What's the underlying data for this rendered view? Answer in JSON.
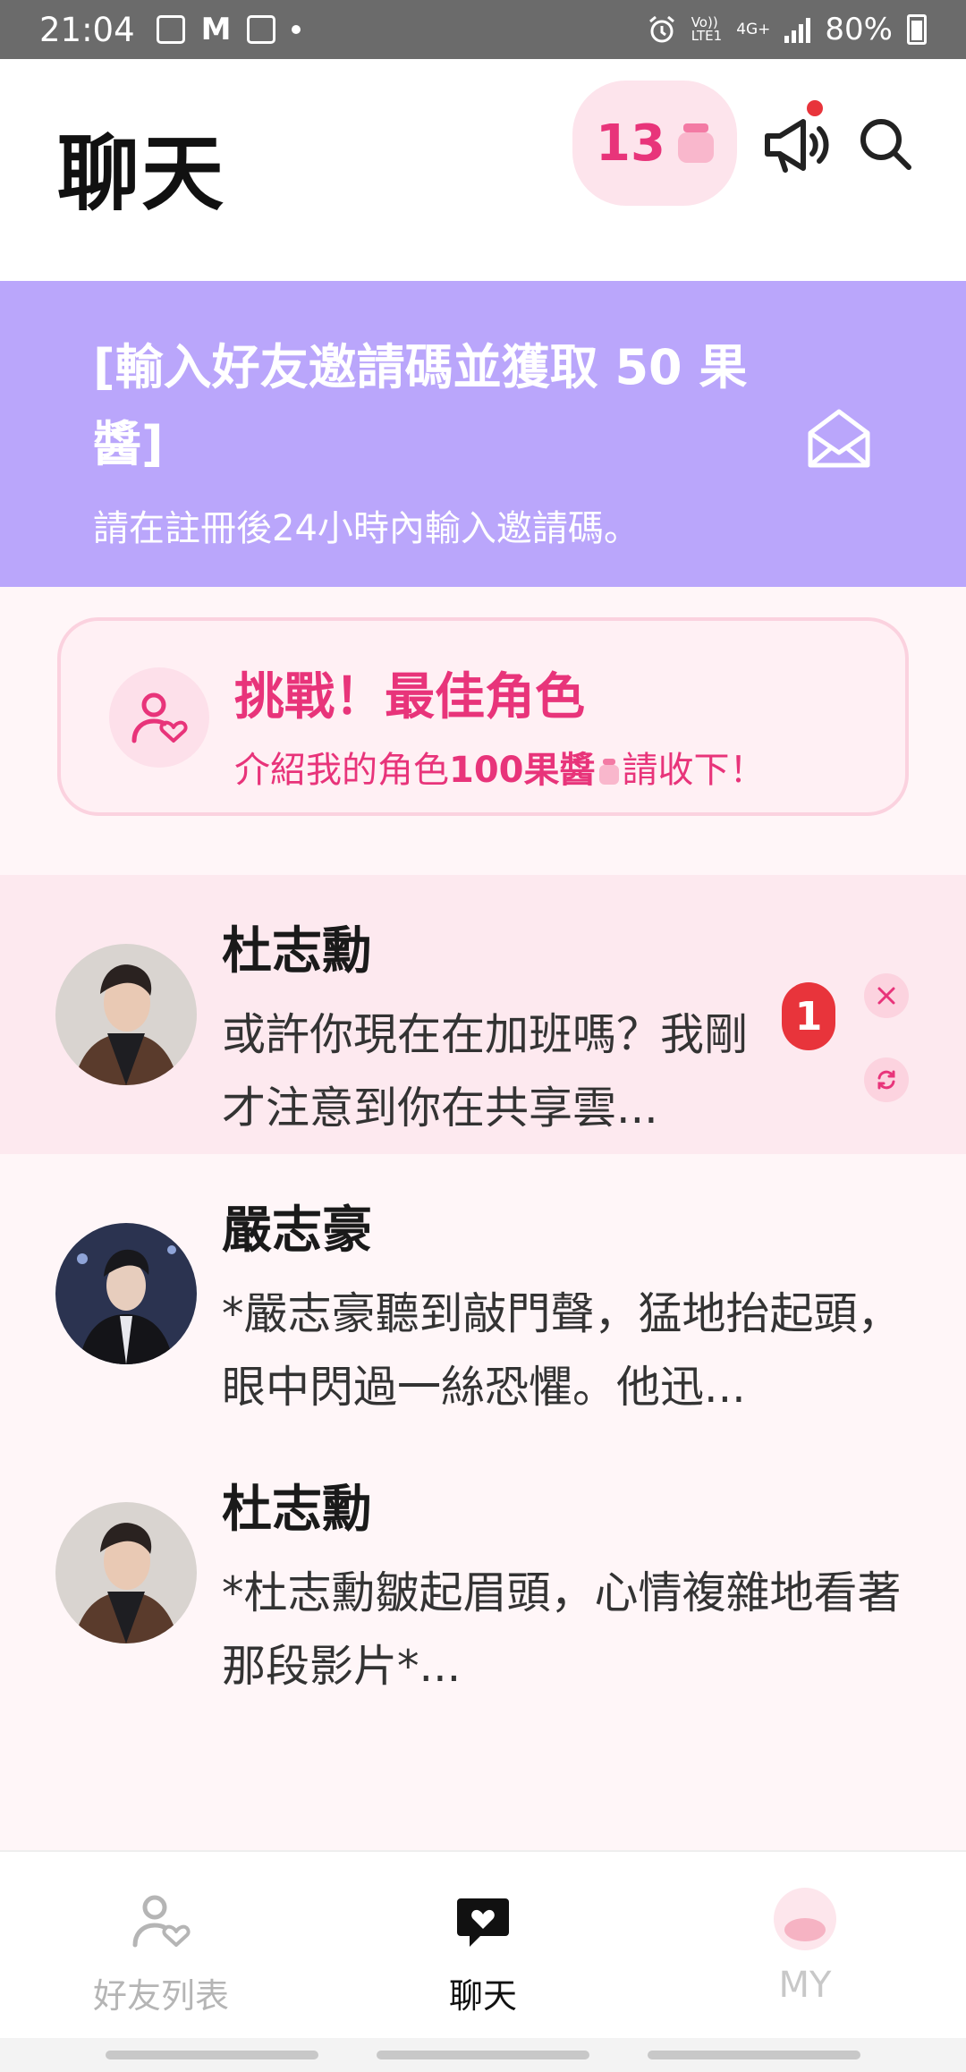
{
  "status_bar": {
    "time": "21:04",
    "battery": "80%",
    "network_top": "Vo))",
    "network_bottom": "LTE1",
    "data_type": "4G+"
  },
  "header": {
    "title": "聊天",
    "jam_count": "13"
  },
  "invite_banner": {
    "title": "[輸入好友邀請碼並獲取 50 果醬]",
    "subtitle": "請在註冊後24小時內輸入邀請碼。"
  },
  "challenge": {
    "title": "挑戰！最佳角色",
    "desc_prefix": "介紹我的角色",
    "desc_bold": "100果醬",
    "desc_suffix": "請收下！"
  },
  "chats": [
    {
      "name": "杜志勳",
      "message": "或許你現在在加班嗎？我剛才注意到你在共享雲...",
      "unread": "1"
    },
    {
      "name": "嚴志豪",
      "message": "*嚴志豪聽到敲門聲，猛地抬起頭，眼中閃過一絲恐懼。他迅..."
    },
    {
      "name": "杜志勳",
      "message": "*杜志勳皺起眉頭，心情複雜地看著那段影片*..."
    }
  ],
  "bottom_nav": {
    "friends": "好友列表",
    "chat": "聊天",
    "my": "MY"
  },
  "colors": {
    "accent": "#e8347a",
    "banner": "#baa6fb",
    "badge": "#e8343b"
  }
}
